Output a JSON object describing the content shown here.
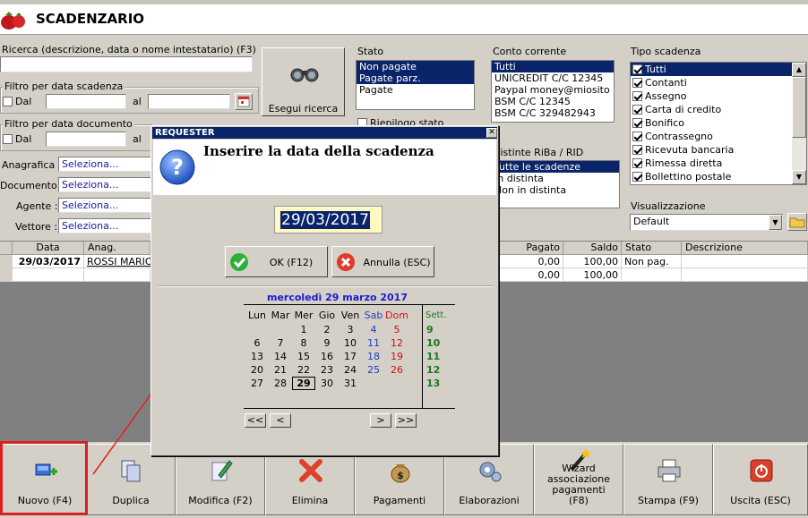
{
  "app": {
    "title": "SCADENZARIO"
  },
  "search": {
    "ricerca_label": "Ricerca (descrizione, data o nome intestatario) (F3)",
    "ricerca_value": "",
    "filtro_scad_label": "Filtro per data scadenza",
    "filtro_doc_label": "Filtro per data documento",
    "dal": "Dal",
    "al": "al",
    "esegui": "Esegui ricerca"
  },
  "fields": [
    {
      "label": "Anagrafica :",
      "value": "Seleziona..."
    },
    {
      "label": "Documento :",
      "value": "Seleziona..."
    },
    {
      "label": "Agente :",
      "value": "Seleziona..."
    },
    {
      "label": "Vettore :",
      "value": "Seleziona..."
    }
  ],
  "stato": {
    "title": "Stato",
    "items": [
      "Non pagate",
      "Pagate parz.",
      "Pagate"
    ],
    "selected": [
      true,
      true,
      false
    ],
    "check_label": "Riepilogo stato"
  },
  "conto": {
    "title": "Conto corrente",
    "items": [
      "Tutti",
      "UNICREDIT C/C 12345",
      "Paypal money@miosito",
      "BSM C/C 12345",
      "BSM C/C 329482943"
    ]
  },
  "distinte": {
    "title": "Distinte RiBa / RID",
    "items": [
      "Tutte le scadenze",
      "In distinta",
      "Non in distinta"
    ]
  },
  "tipo": {
    "title": "Tipo scadenza",
    "items": [
      "Tutti",
      "Contanti",
      "Assegno",
      "Carta di credito",
      "Bonifico",
      "Contrassegno",
      "Ricevuta bancaria",
      "Rimessa diretta",
      "Bollettino postale"
    ]
  },
  "visual": {
    "title": "Visualizzazione",
    "value": "Default"
  },
  "grid": {
    "headers": {
      "data": "Data",
      "anag": "Anag.",
      "pagato": "Pagato",
      "saldo": "Saldo",
      "stato": "Stato",
      "descr": "Descrizione"
    },
    "rows": [
      {
        "data": "29/03/2017",
        "anag": "ROSSI MARIO",
        "pagato": "0,00",
        "saldo": "100,00",
        "stato": "Non pag."
      },
      {
        "data": "",
        "anag": "",
        "pagato": "0,00",
        "saldo": "100,00",
        "stato": ""
      }
    ]
  },
  "toolbar": [
    {
      "label": "Nuovo (F4)",
      "icon": "new-icon"
    },
    {
      "label": "Duplica",
      "icon": "duplicate-icon"
    },
    {
      "label": "Modifica (F2)",
      "icon": "edit-icon"
    },
    {
      "label": "Elimina",
      "icon": "delete-icon"
    },
    {
      "label": "Pagamenti",
      "icon": "money-bag-icon"
    },
    {
      "label": "Elaborazioni",
      "icon": "gears-icon"
    },
    {
      "label": "Wizard associazione pagamenti (F8)",
      "icon": "wizard-icon"
    },
    {
      "label": "Stampa (F9)",
      "icon": "printer-icon"
    },
    {
      "label": "Uscita (ESC)",
      "icon": "power-icon"
    }
  ],
  "dialog": {
    "title": "REQUESTER",
    "prompt": "Inserire la data della scadenza",
    "date_value": "29/03/2017",
    "ok": "OK (F12)",
    "cancel": "Annulla (ESC)",
    "calendar": {
      "header": "mercoledì 29 marzo 2017",
      "days": [
        "Lun",
        "Mar",
        "Mer",
        "Gio",
        "Ven",
        "Sab",
        "Dom"
      ],
      "weeks_label": "Sett.",
      "rows": [
        [
          "",
          "",
          "1",
          "2",
          "3",
          "4",
          "5"
        ],
        [
          "6",
          "7",
          "8",
          "9",
          "10",
          "11",
          "12"
        ],
        [
          "13",
          "14",
          "15",
          "16",
          "17",
          "18",
          "19"
        ],
        [
          "20",
          "21",
          "22",
          "23",
          "24",
          "25",
          "26"
        ],
        [
          "27",
          "28",
          "29",
          "30",
          "31",
          "",
          ""
        ]
      ],
      "weeks": [
        "9",
        "10",
        "11",
        "12",
        "13"
      ],
      "selected_day": "29",
      "nav": [
        "<<",
        "<",
        ">",
        ">>"
      ]
    }
  },
  "colors": {
    "selection": "#0a246a",
    "saturday": "#1f3fc4",
    "sunday": "#d01010",
    "week": "#1a7a1a",
    "highlight": "#cc0000"
  }
}
